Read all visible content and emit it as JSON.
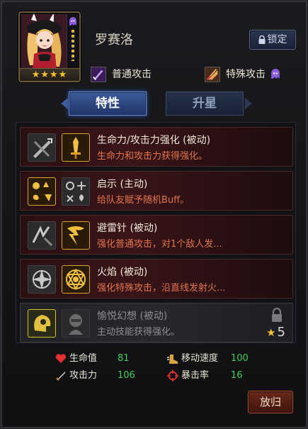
{
  "hero": {
    "name": "罗赛洛",
    "stars": "★★★★",
    "lock_label": "锁定"
  },
  "attacks": {
    "normal_label": "普通攻击",
    "special_label": "特殊攻击"
  },
  "tabs": [
    {
      "label": "特性",
      "active": true
    },
    {
      "label": "升星",
      "active": false
    }
  ],
  "skills": [
    {
      "name": "生命力/攻击力强化 (被动)",
      "desc": "生命力和攻击力获得强化。",
      "locked": false
    },
    {
      "name": "启示 (主动)",
      "desc": "给队友赋予随机Buff。",
      "locked": false
    },
    {
      "name": "避雷针 (被动)",
      "desc": "强化普通攻击，对1个敌人发...",
      "locked": false
    },
    {
      "name": "火焰 (被动)",
      "desc": "强化特殊攻击，沿直线发射火...",
      "locked": false
    },
    {
      "name": "愉悦幻想 (被动)",
      "desc": "主动技能获得强化。",
      "locked": true,
      "star_cost": "5"
    }
  ],
  "stats": {
    "hp_label": "生命值",
    "hp_value": "81",
    "atk_label": "攻击力",
    "atk_value": "106",
    "speed_label": "移动速度",
    "speed_value": "100",
    "crit_label": "暴击率",
    "crit_value": "16"
  },
  "back_label": "放归",
  "colors": {
    "skill_desc": "#e0754e",
    "stat_value": "#3fd05a",
    "star": "#f2c230",
    "active_tab": "#3c5a9a"
  }
}
